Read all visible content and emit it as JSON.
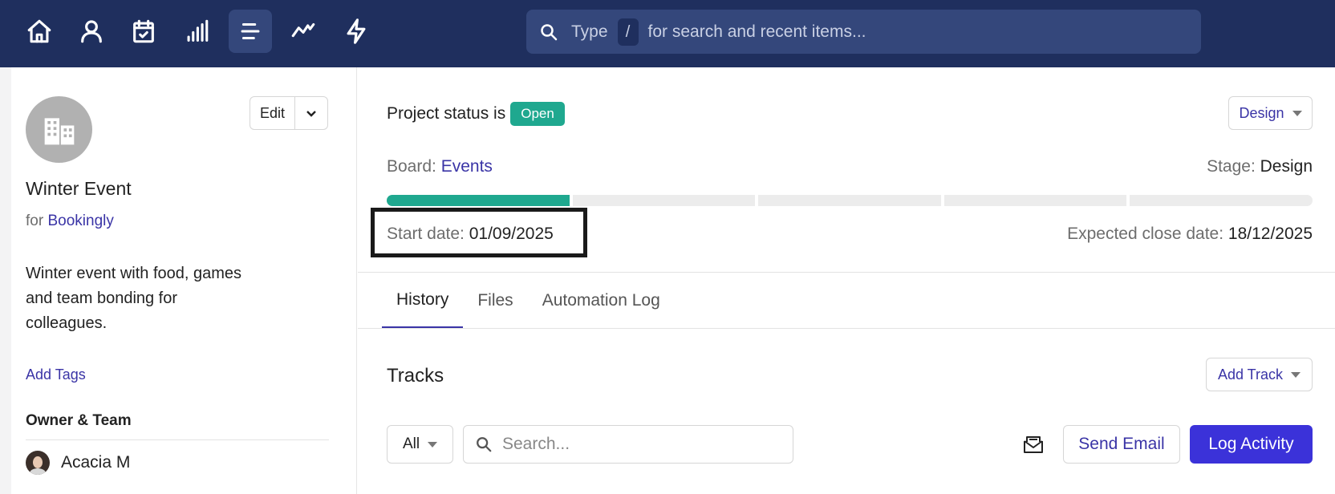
{
  "nav": {
    "icons": [
      "home-icon",
      "user-icon",
      "calendar-icon",
      "bar-chart-icon",
      "list-icon",
      "trend-icon",
      "lightning-icon"
    ],
    "active": "list-icon"
  },
  "search": {
    "prefix": "Type",
    "key": "/",
    "suffix": "for search and recent items..."
  },
  "sidebar": {
    "edit_label": "Edit",
    "title": "Winter Event",
    "for_label": "for",
    "company": "Bookingly",
    "description": "Winter event with food, games and team bonding for colleagues.",
    "add_tags": "Add Tags",
    "owner_heading": "Owner & Team",
    "owner_name": "Acacia M"
  },
  "project": {
    "status_prefix": "Project status is",
    "status": "Open",
    "stage_dropdown": "Design",
    "board_label": "Board:",
    "board": "Events",
    "stage_label": "Stage:",
    "stage": "Design",
    "progress_completed_segments": 1,
    "progress_total_segments": 5,
    "start_label": "Start date:",
    "start_date": "01/09/2025",
    "close_label": "Expected close date:",
    "close_date": "18/12/2025"
  },
  "tabs": [
    {
      "label": "History",
      "active": true
    },
    {
      "label": "Files",
      "active": false
    },
    {
      "label": "Automation Log",
      "active": false
    }
  ],
  "tracks": {
    "title": "Tracks",
    "add_track": "Add Track",
    "filter_value": "All",
    "search_placeholder": "Search...",
    "send_email": "Send Email",
    "log_activity": "Log Activity"
  },
  "colors": {
    "nav_bg": "#1f2f5e",
    "accent": "#3a34a6",
    "status_green": "#1fa88f",
    "primary_button": "#3b32d9"
  }
}
